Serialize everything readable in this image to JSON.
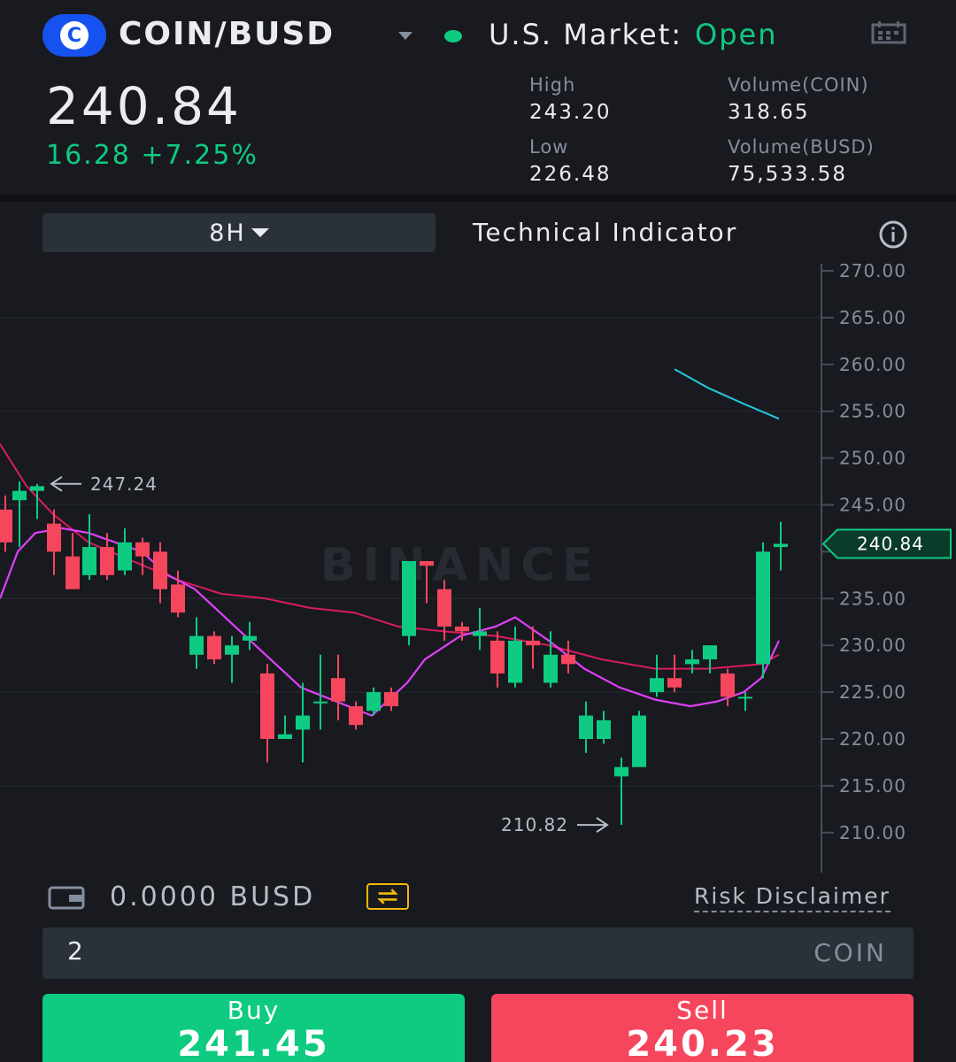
{
  "header": {
    "logo_letter": "C",
    "pair": "COIN/BUSD",
    "market_label": "U.S. Market:",
    "market_status": "Open",
    "last_price": "240.84",
    "change": "16.28 +7.25%",
    "stats": {
      "high_label": "High",
      "high": "243.20",
      "low_label": "Low",
      "low": "226.48",
      "vol_coin_label": "Volume(COIN)",
      "vol_coin": "318.65",
      "vol_busd_label": "Volume(BUSD)",
      "vol_busd": "75,533.58"
    }
  },
  "toolbar": {
    "interval": "8H",
    "indicator_label": "Technical Indicator"
  },
  "chart_data": {
    "type": "candlestick",
    "watermark": "BINANCE",
    "y_ticks": [
      "270.00",
      "265.00",
      "260.00",
      "255.00",
      "250.00",
      "245.00",
      "240.00",
      "235.00",
      "230.00",
      "225.00",
      "220.00",
      "215.00",
      "210.00"
    ],
    "ylim": [
      206.5,
      270.5
    ],
    "current_price": 240.84,
    "high_marker": 247.24,
    "low_marker": 210.82,
    "candles": [
      {
        "x": 6,
        "o": 244.5,
        "c": 241.0,
        "h": 246.0,
        "l": 240.0
      },
      {
        "x": 22,
        "o": 245.5,
        "c": 246.5,
        "h": 247.5,
        "l": 240.5
      },
      {
        "x": 42,
        "o": 246.5,
        "c": 247.0,
        "h": 247.24,
        "l": 243.5
      },
      {
        "x": 61,
        "o": 243.0,
        "c": 240.0,
        "h": 244.5,
        "l": 237.5
      },
      {
        "x": 82,
        "o": 239.5,
        "c": 236.0,
        "h": 242.0,
        "l": 236.0
      },
      {
        "x": 101,
        "o": 237.5,
        "c": 240.5,
        "h": 244.0,
        "l": 237.0
      },
      {
        "x": 121,
        "o": 240.5,
        "c": 237.5,
        "h": 242.0,
        "l": 237.0
      },
      {
        "x": 141,
        "o": 238.0,
        "c": 241.0,
        "h": 242.5,
        "l": 237.5
      },
      {
        "x": 161,
        "o": 241.0,
        "c": 239.5,
        "h": 241.5,
        "l": 237.5
      },
      {
        "x": 181,
        "o": 240.0,
        "c": 236.0,
        "h": 241.0,
        "l": 234.5
      },
      {
        "x": 201,
        "o": 236.5,
        "c": 233.5,
        "h": 238.0,
        "l": 233.0
      },
      {
        "x": 222,
        "o": 229.0,
        "c": 231.0,
        "h": 233.0,
        "l": 227.5
      },
      {
        "x": 242,
        "o": 231.0,
        "c": 228.5,
        "h": 231.5,
        "l": 228.0
      },
      {
        "x": 262,
        "o": 229.0,
        "c": 230.0,
        "h": 231.0,
        "l": 226.0
      },
      {
        "x": 282,
        "o": 230.5,
        "c": 231.0,
        "h": 232.5,
        "l": 229.5
      },
      {
        "x": 302,
        "o": 227.0,
        "c": 220.0,
        "h": 228.0,
        "l": 217.5
      },
      {
        "x": 322,
        "o": 220.0,
        "c": 220.5,
        "h": 222.5,
        "l": 220.0
      },
      {
        "x": 342,
        "o": 221.0,
        "c": 222.5,
        "h": 226.0,
        "l": 217.5
      },
      {
        "x": 362,
        "o": 224.0,
        "c": 224.0,
        "h": 229.0,
        "l": 221.0
      },
      {
        "x": 382,
        "o": 226.5,
        "c": 224.0,
        "h": 229.0,
        "l": 222.0
      },
      {
        "x": 402,
        "o": 223.5,
        "c": 221.5,
        "h": 224.0,
        "l": 221.0
      },
      {
        "x": 422,
        "o": 223.0,
        "c": 225.0,
        "h": 225.5,
        "l": 222.5
      },
      {
        "x": 442,
        "o": 225.0,
        "c": 223.5,
        "h": 225.5,
        "l": 223.0
      },
      {
        "x": 462,
        "o": 231.0,
        "c": 239.0,
        "h": 239.0,
        "l": 230.0
      },
      {
        "x": 482,
        "o": 239.0,
        "c": 238.5,
        "h": 239.0,
        "l": 234.5
      },
      {
        "x": 502,
        "o": 236.0,
        "c": 232.0,
        "h": 237.0,
        "l": 230.5
      },
      {
        "x": 522,
        "o": 232.0,
        "c": 231.5,
        "h": 232.5,
        "l": 230.5
      },
      {
        "x": 542,
        "o": 231.0,
        "c": 231.5,
        "h": 234.0,
        "l": 229.5
      },
      {
        "x": 562,
        "o": 230.5,
        "c": 227.0,
        "h": 231.5,
        "l": 225.5
      },
      {
        "x": 582,
        "o": 226.0,
        "c": 230.5,
        "h": 232.0,
        "l": 225.5
      },
      {
        "x": 602,
        "o": 230.5,
        "c": 230.0,
        "h": 232.0,
        "l": 227.5
      },
      {
        "x": 622,
        "o": 226.0,
        "c": 229.0,
        "h": 231.5,
        "l": 225.5
      },
      {
        "x": 642,
        "o": 229.0,
        "c": 228.0,
        "h": 230.5,
        "l": 227.0
      },
      {
        "x": 662,
        "o": 220.0,
        "c": 222.5,
        "h": 224.0,
        "l": 218.5
      },
      {
        "x": 682,
        "o": 220.0,
        "c": 222.0,
        "h": 223.0,
        "l": 219.5
      },
      {
        "x": 702,
        "o": 216.0,
        "c": 217.0,
        "h": 218.0,
        "l": 210.82
      },
      {
        "x": 722,
        "o": 217.0,
        "c": 222.5,
        "h": 223.0,
        "l": 217.0
      },
      {
        "x": 742,
        "o": 225.0,
        "c": 226.5,
        "h": 229.0,
        "l": 224.5
      },
      {
        "x": 762,
        "o": 226.5,
        "c": 225.5,
        "h": 229.0,
        "l": 225.0
      },
      {
        "x": 782,
        "o": 228.0,
        "c": 228.5,
        "h": 229.5,
        "l": 227.0
      },
      {
        "x": 802,
        "o": 228.5,
        "c": 230.0,
        "h": 230.0,
        "l": 227.0
      },
      {
        "x": 822,
        "o": 227.0,
        "c": 224.5,
        "h": 227.5,
        "l": 223.5
      },
      {
        "x": 842,
        "o": 224.5,
        "c": 224.5,
        "h": 225.0,
        "l": 223.0
      },
      {
        "x": 862,
        "o": 228.0,
        "c": 240.0,
        "h": 241.0,
        "l": 226.5
      },
      {
        "x": 882,
        "o": 240.5,
        "c": 240.84,
        "h": 243.2,
        "l": 238.0
      }
    ],
    "ma_fast": [
      [
        0,
        235
      ],
      [
        20,
        240
      ],
      [
        40,
        242
      ],
      [
        70,
        242.5
      ],
      [
        100,
        242
      ],
      [
        130,
        241
      ],
      [
        160,
        240
      ],
      [
        190,
        237.5
      ],
      [
        220,
        236
      ],
      [
        260,
        232.5
      ],
      [
        300,
        229
      ],
      [
        340,
        225.5
      ],
      [
        380,
        224
      ],
      [
        420,
        222.5
      ],
      [
        460,
        226
      ],
      [
        480,
        228.5
      ],
      [
        520,
        231
      ],
      [
        560,
        232
      ],
      [
        582,
        233
      ],
      [
        620,
        230.5
      ],
      [
        660,
        227.5
      ],
      [
        700,
        225.5
      ],
      [
        740,
        224.2
      ],
      [
        780,
        223.5
      ],
      [
        810,
        224
      ],
      [
        840,
        225
      ],
      [
        860,
        226.5
      ],
      [
        880,
        230.5
      ]
    ],
    "ma_slow": [
      [
        0,
        251.5
      ],
      [
        30,
        247
      ],
      [
        60,
        244
      ],
      [
        100,
        241
      ],
      [
        150,
        239
      ],
      [
        200,
        237
      ],
      [
        250,
        235.5
      ],
      [
        300,
        235
      ],
      [
        350,
        234
      ],
      [
        400,
        233.5
      ],
      [
        450,
        232
      ],
      [
        500,
        231.5
      ],
      [
        560,
        231
      ],
      [
        620,
        230
      ],
      [
        680,
        228.5
      ],
      [
        740,
        227.5
      ],
      [
        800,
        227.5
      ],
      [
        860,
        228
      ],
      [
        880,
        229
      ]
    ],
    "ma_long": [
      [
        762,
        259.5
      ],
      [
        800,
        257.5
      ],
      [
        840,
        255.8
      ],
      [
        880,
        254.2
      ]
    ]
  },
  "account": {
    "balance": "0.0000 BUSD",
    "risk": "Risk Disclaimer"
  },
  "order": {
    "quantity": "2",
    "unit": "COIN",
    "buy_label": "Buy",
    "buy_price": "241.45",
    "sell_label": "Sell",
    "sell_price": "240.23"
  },
  "colors": {
    "up": "#0ecb81",
    "down": "#f6465d",
    "ma_fast": "#e040fb",
    "ma_slow": "#d81b60",
    "ma_long": "#26c6da",
    "accent": "#f0b90b"
  }
}
